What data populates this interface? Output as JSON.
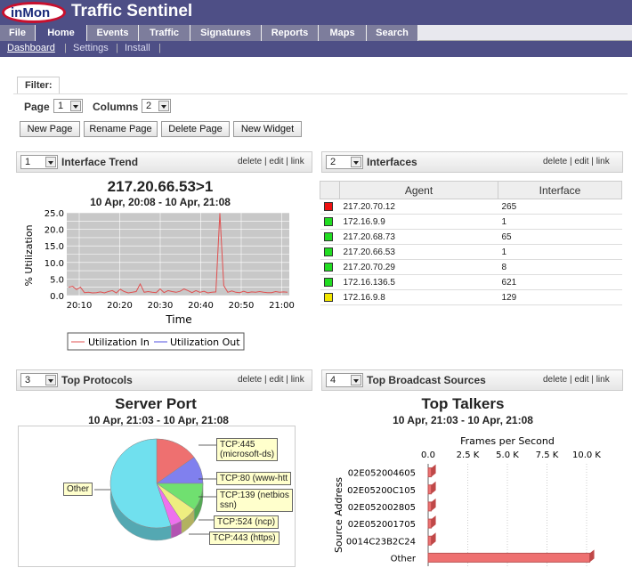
{
  "header": {
    "logo_text": "inMon",
    "title": "Traffic Sentinel"
  },
  "menu": [
    "File",
    "Home",
    "Events",
    "Traffic",
    "Signatures",
    "Reports",
    "Maps",
    "Search"
  ],
  "menu_active": "Home",
  "subnav": [
    "Dashboard",
    "Settings",
    "Install"
  ],
  "filter": {
    "tab_label": "Filter:",
    "page_label": "Page",
    "page_value": "1",
    "columns_label": "Columns",
    "columns_value": "2",
    "buttons": [
      "New Page",
      "Rename Page",
      "Delete Page",
      "New Widget"
    ]
  },
  "widget_links": [
    "delete",
    "edit",
    "link"
  ],
  "widgets": {
    "trend": {
      "index": "1",
      "title": "Interface Trend"
    },
    "interfaces": {
      "index": "2",
      "title": "Interfaces"
    },
    "protocols": {
      "index": "3",
      "title": "Top Protocols"
    },
    "broadcast": {
      "index": "4",
      "title": "Top Broadcast Sources"
    }
  },
  "interfaces_table": {
    "headers": [
      "Agent",
      "Interface"
    ],
    "rows": [
      {
        "agent": "217.20.70.12",
        "interface": "265",
        "color": "#ee1111"
      },
      {
        "agent": "172.16.9.9",
        "interface": "1",
        "color": "#22dd22"
      },
      {
        "agent": "217.20.68.73",
        "interface": "65",
        "color": "#22dd22"
      },
      {
        "agent": "217.20.66.53",
        "interface": "1",
        "color": "#22dd22"
      },
      {
        "agent": "217.20.70.29",
        "interface": "8",
        "color": "#22dd22"
      },
      {
        "agent": "172.16.136.5",
        "interface": "621",
        "color": "#22dd22"
      },
      {
        "agent": "172.16.9.8",
        "interface": "129",
        "color": "#f2e600"
      }
    ]
  },
  "chart_data": [
    {
      "type": "line",
      "title": "217.20.66.53>1",
      "subtitle": "10 Apr, 20:08 -  10 Apr, 21:08",
      "xlabel": "Time",
      "ylabel": "% Utilization",
      "x_ticks": [
        "20:10",
        "20:20",
        "20:30",
        "20:40",
        "20:50",
        "21:00"
      ],
      "y_ticks": [
        "0.0",
        "2.5",
        "5.0",
        "7.5",
        "10.0",
        "12.5",
        "15.0",
        "17.5",
        "20.0",
        "22.5",
        "25.0"
      ],
      "ylim": [
        0,
        25
      ],
      "grid": true,
      "legend": "bottom",
      "series": [
        {
          "name": "Utilization In",
          "color": "#e05050",
          "values": [
            2.5,
            2.8,
            1.8,
            2.5,
            0.9,
            1.0,
            0.8,
            0.9,
            1.1,
            0.8,
            1.2,
            1.5,
            0.8,
            1.9,
            1.2,
            0.8,
            1.0,
            1.2,
            3.5,
            1.0,
            1.2,
            1.0,
            0.9,
            2.0,
            0.9,
            1.5,
            1.2,
            1.0,
            1.3,
            2.0,
            1.5,
            0.9,
            1.5,
            1.0,
            1.3,
            0.8,
            1.0,
            1.1,
            24.9,
            3.0,
            1.0,
            1.4,
            1.0,
            0.9,
            1.3,
            0.9,
            1.1,
            1.0,
            1.2,
            1.0,
            0.9,
            0.9,
            1.2,
            1.0,
            1.1,
            1.0
          ]
        },
        {
          "name": "Utilization Out",
          "color": "#5050e0",
          "values": []
        }
      ]
    },
    {
      "type": "pie",
      "title": "Server Port",
      "subtitle": "10 Apr, 21:03 -  10 Apr, 21:08",
      "slices": [
        {
          "label": "TCP:445\n(microsoft-ds)",
          "value": 15,
          "color": "#ee7070"
        },
        {
          "label": "TCP:80 (www-htt",
          "value": 10,
          "color": "#8080ee"
        },
        {
          "label": "TCP:139 (netbios\nssn)",
          "value": 10,
          "color": "#70e070"
        },
        {
          "label": "TCP:524 (ncp)",
          "value": 6,
          "color": "#eeee80"
        },
        {
          "label": "TCP:443 (https)",
          "value": 4,
          "color": "#ee70ee"
        },
        {
          "label": "Other",
          "value": 55,
          "color": "#70e0ee"
        }
      ]
    },
    {
      "type": "bar",
      "orientation": "horizontal",
      "title": "Top Talkers",
      "subtitle": "10 Apr, 21:03 -  10 Apr, 21:08",
      "xlabel": "Frames per Second",
      "ylabel": "Source Address",
      "x_ticks": [
        "0.0",
        "2.5 K",
        "5.0 K",
        "7.5 K",
        "10.0 K"
      ],
      "xlim": [
        0,
        10000
      ],
      "categories": [
        "02E052004605",
        "02E05200C105",
        "02E052002805",
        "02E052001705",
        "0014C23B2C24",
        "Other"
      ],
      "values": [
        200,
        200,
        200,
        200,
        200,
        10200
      ],
      "color": "#ee7070"
    }
  ]
}
